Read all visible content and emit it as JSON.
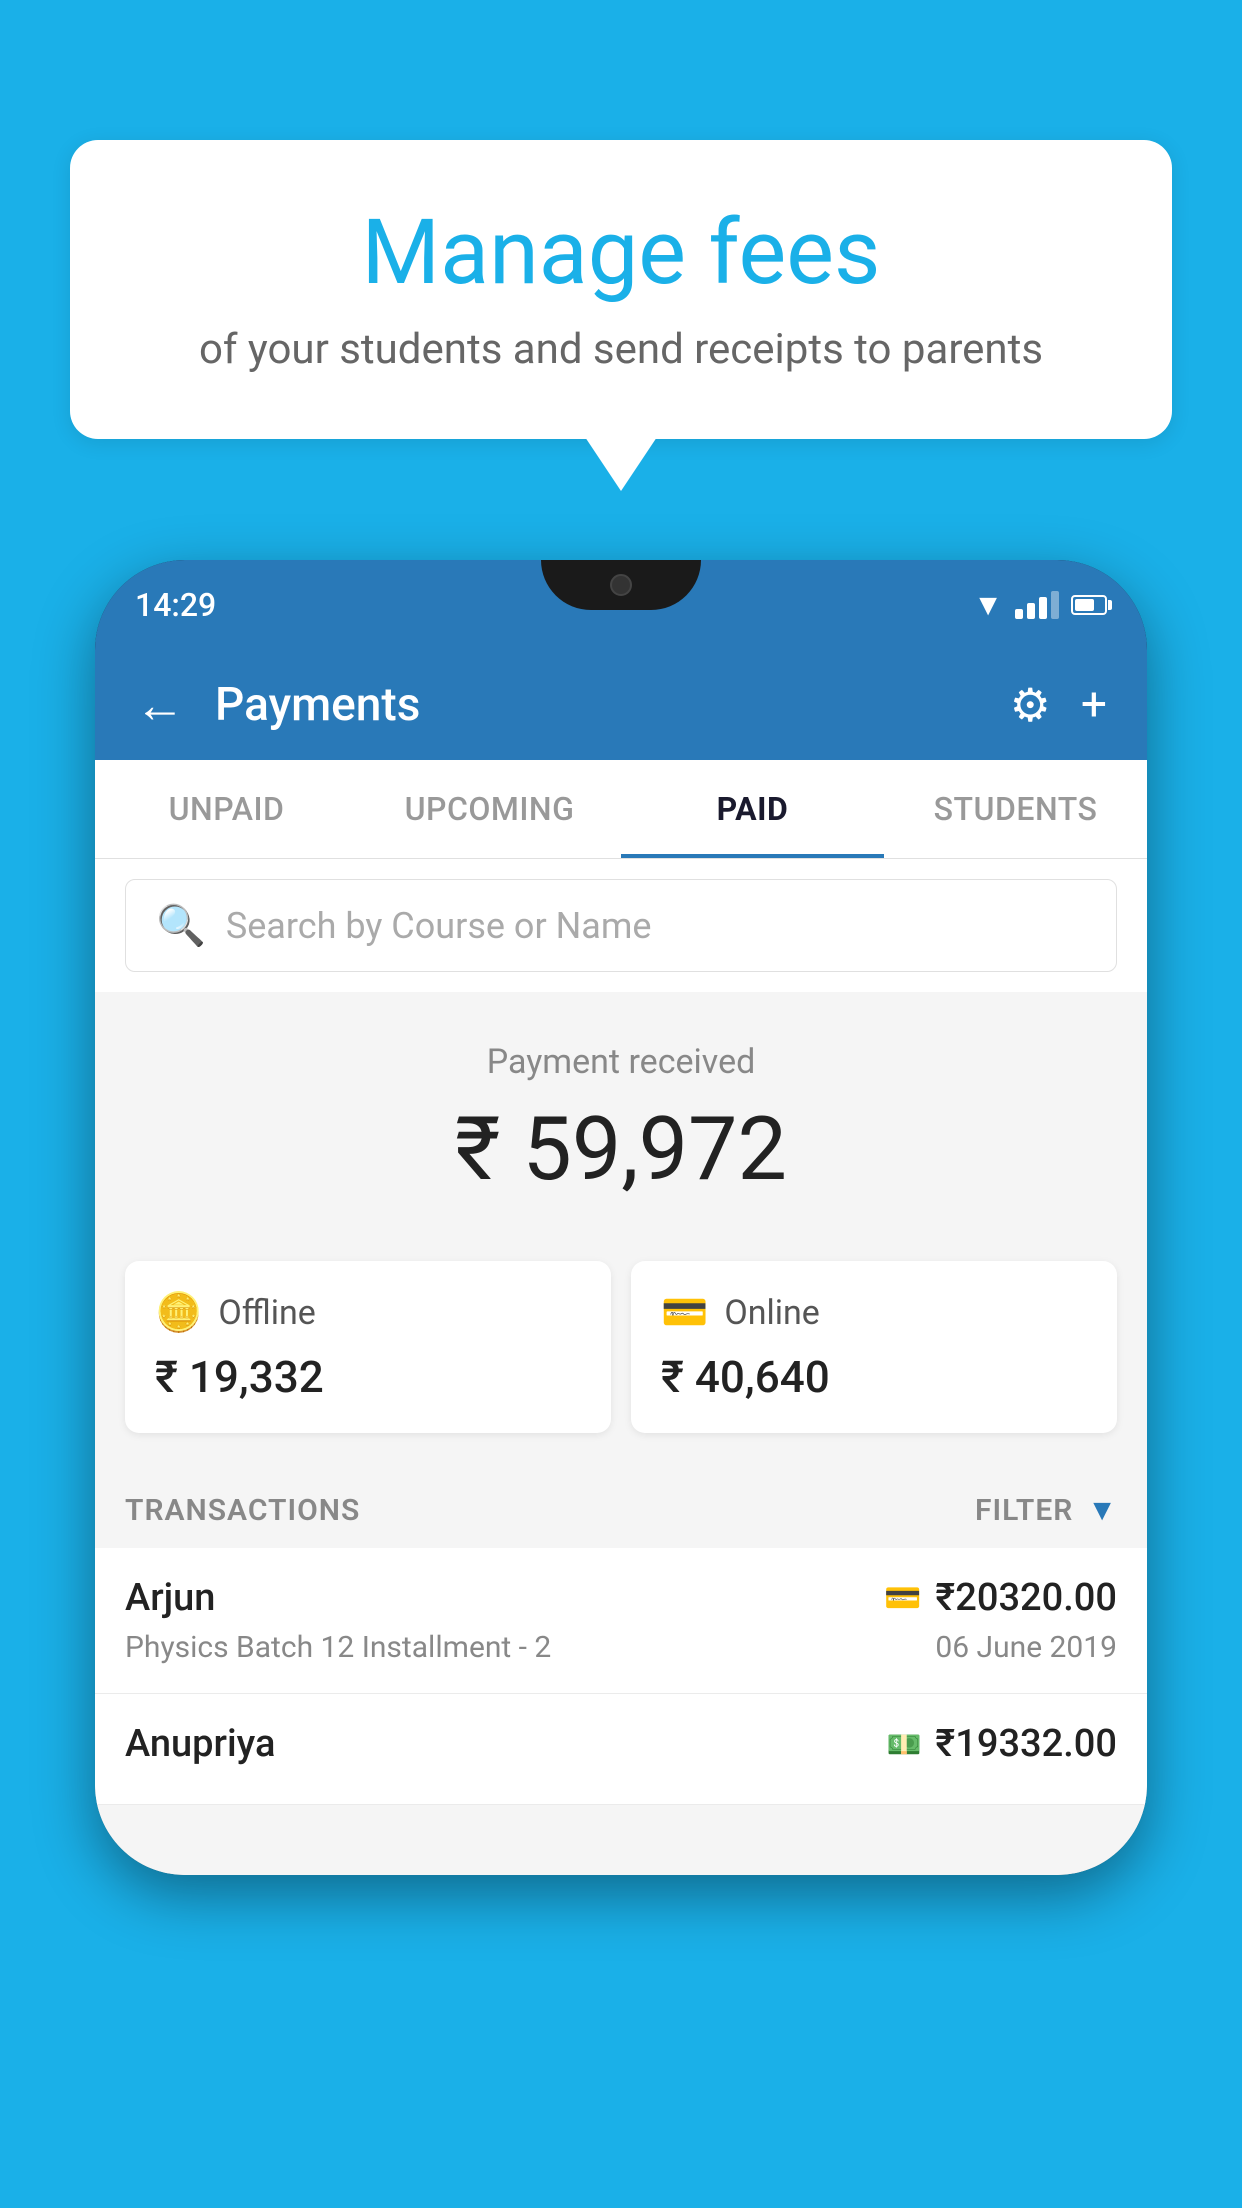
{
  "page": {
    "background_color": "#1ab0e8"
  },
  "speech_bubble": {
    "title": "Manage fees",
    "subtitle": "of your students and send receipts to parents"
  },
  "phone": {
    "status_bar": {
      "time": "14:29"
    },
    "header": {
      "title": "Payments",
      "back_label": "←",
      "gear_label": "⚙",
      "plus_label": "+"
    },
    "tabs": [
      {
        "label": "UNPAID",
        "active": false
      },
      {
        "label": "UPCOMING",
        "active": false
      },
      {
        "label": "PAID",
        "active": true
      },
      {
        "label": "STUDENTS",
        "active": false
      }
    ],
    "search": {
      "placeholder": "Search by Course or Name"
    },
    "payment_summary": {
      "received_label": "Payment received",
      "total_amount": "₹ 59,972",
      "offline_label": "Offline",
      "offline_amount": "₹ 19,332",
      "online_label": "Online",
      "online_amount": "₹ 40,640"
    },
    "transactions": {
      "section_label": "TRANSACTIONS",
      "filter_label": "FILTER",
      "items": [
        {
          "name": "Arjun",
          "amount": "₹20320.00",
          "detail": "Physics Batch 12 Installment - 2",
          "date": "06 June 2019",
          "payment_type": "card"
        },
        {
          "name": "Anupriya",
          "amount": "₹19332.00",
          "detail": "",
          "date": "",
          "payment_type": "cash"
        }
      ]
    }
  }
}
